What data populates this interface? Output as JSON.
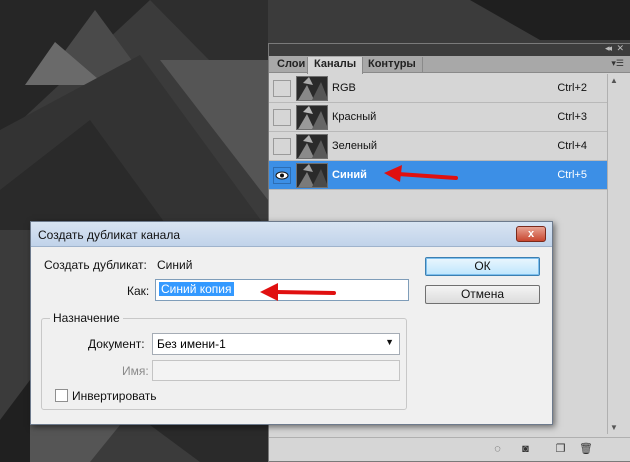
{
  "panel": {
    "tabs": [
      {
        "label": "Слои"
      },
      {
        "label": "Каналы"
      },
      {
        "label": "Контуры"
      }
    ],
    "channels": [
      {
        "name": "RGB",
        "shortcut": "Ctrl+2",
        "visible": false,
        "selected": false
      },
      {
        "name": "Красный",
        "shortcut": "Ctrl+3",
        "visible": false,
        "selected": false
      },
      {
        "name": "Зеленый",
        "shortcut": "Ctrl+4",
        "visible": false,
        "selected": false
      },
      {
        "name": "Синий",
        "shortcut": "Ctrl+5",
        "visible": true,
        "selected": true
      }
    ],
    "bottom_icons": [
      "load-selection-icon",
      "save-selection-icon",
      "new-channel-icon",
      "trash-icon"
    ]
  },
  "dialog": {
    "title": "Создать дубликат канала",
    "close_label": "x",
    "duplicate_label": "Создать дубликат:",
    "duplicate_value": "Синий",
    "as_label": "Как:",
    "as_value": "Синий копия",
    "ok_label": "ОК",
    "cancel_label": "Отмена",
    "destination": {
      "legend": "Назначение",
      "document_label": "Документ:",
      "document_value": "Без имени-1",
      "name_label": "Имя:",
      "name_value": "",
      "invert_label": "Инвертировать",
      "invert_checked": false
    }
  },
  "colors": {
    "selection": "#3c8fe6",
    "annotation_arrow": "#e01010",
    "dialog_close": "#c8462f"
  }
}
